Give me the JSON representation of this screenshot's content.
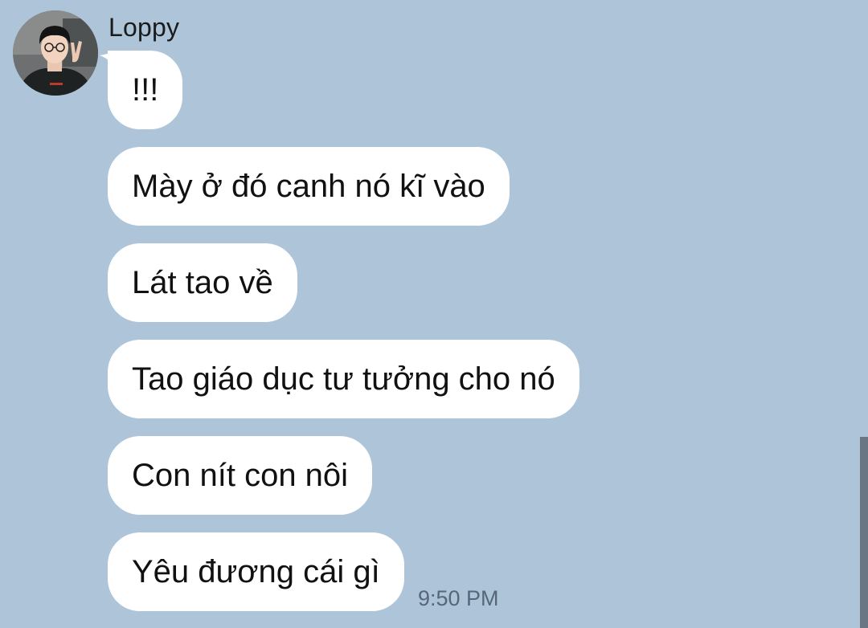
{
  "chat": {
    "sender_name": "Loppy",
    "avatar": {
      "icon": "profile-photo-avatar"
    },
    "messages": [
      {
        "text": "!!!"
      },
      {
        "text": "Mày ở đó canh nó kĩ vào"
      },
      {
        "text": "Lát tao về"
      },
      {
        "text": "Tao giáo dục tư tưởng cho nó"
      },
      {
        "text": "Con nít con nôi"
      },
      {
        "text": "Yêu đương cái gì"
      }
    ],
    "timestamp": "9:50 PM"
  },
  "colors": {
    "background": "#aec4d9",
    "bubble": "#ffffff",
    "text": "#111111",
    "timestamp": "#56677a",
    "scrollbar": "#6a7683"
  }
}
